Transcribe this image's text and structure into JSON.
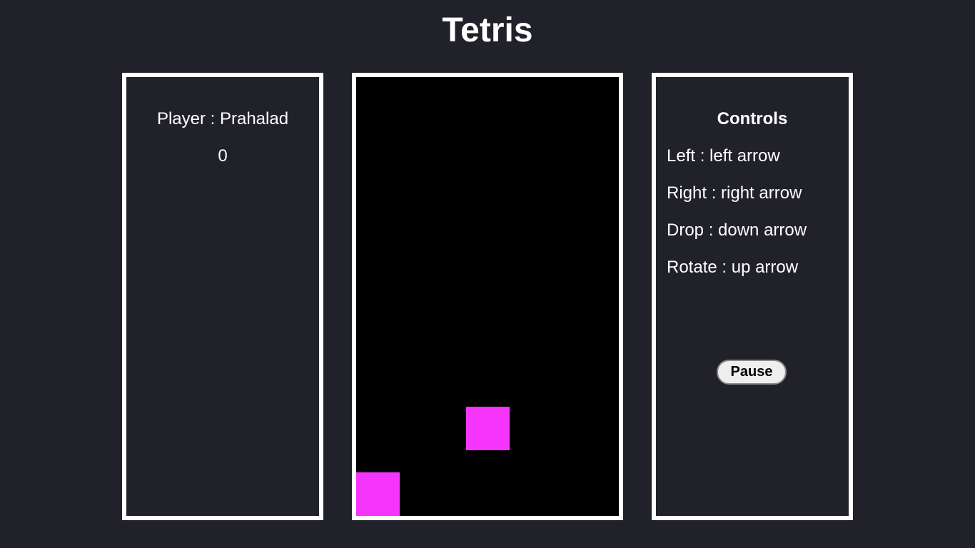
{
  "title": "Tetris",
  "player": {
    "label": "Player : Prahalad",
    "score": "0"
  },
  "controls": {
    "heading": "Controls",
    "left": "Left : left arrow",
    "right": "Right : right arrow",
    "drop": "Drop : down arrow",
    "rotate": "Rotate : up arrow",
    "pause_label": "Pause"
  },
  "board": {
    "block_color": "#f535fc",
    "background_color": "#000000"
  },
  "colors": {
    "page_background": "#212129",
    "panel_border": "#ffffff",
    "text": "#ffffff"
  }
}
